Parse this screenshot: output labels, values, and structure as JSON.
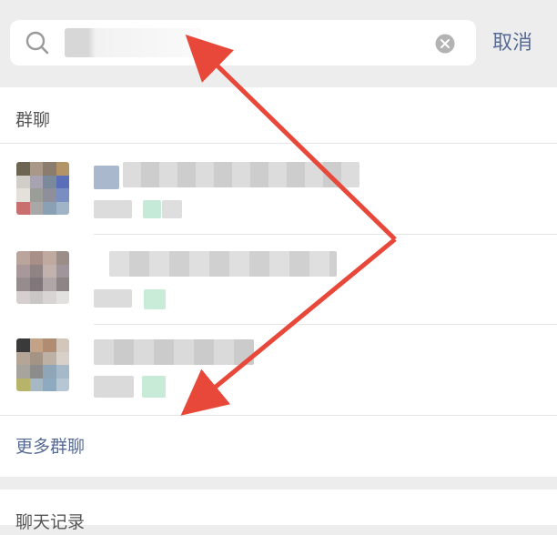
{
  "search": {
    "query": "",
    "cancel_label": "取消"
  },
  "group_section": {
    "title": "群聊",
    "more_label": "更多群聊"
  },
  "chat_history": {
    "title": "聊天记录"
  },
  "icons": {
    "search": "search-icon",
    "clear": "clear-icon"
  },
  "colors": {
    "link": "#576b95",
    "annotation_arrow": "#e8483a",
    "background": "#ededed"
  }
}
